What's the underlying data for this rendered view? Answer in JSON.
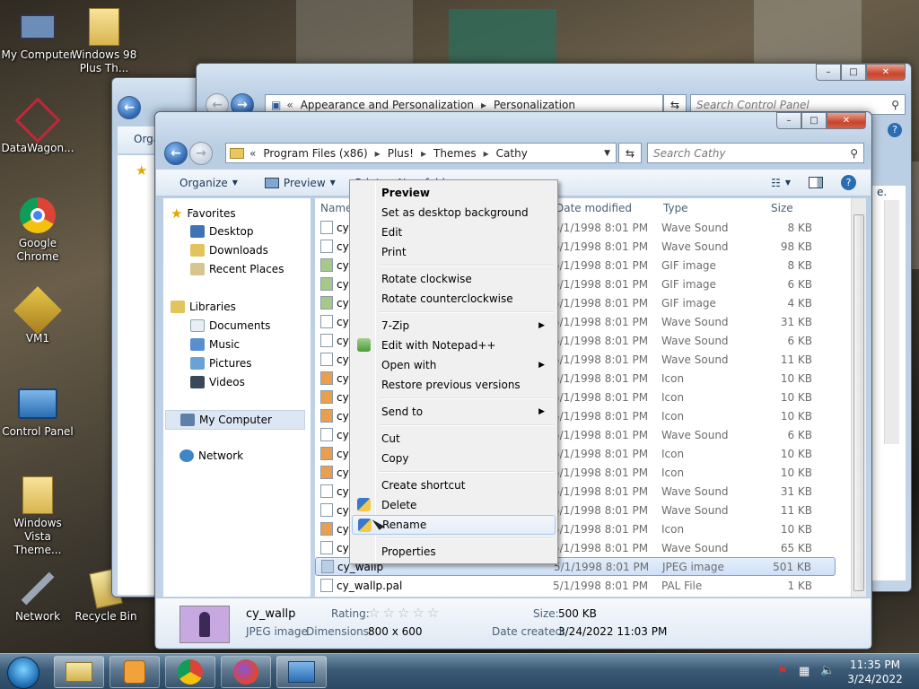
{
  "desktop": {
    "icons": [
      {
        "label": "My Computer",
        "icon": "my-computer-icon"
      },
      {
        "label": "Windows 98 Plus Th...",
        "icon": "folder-icon"
      },
      {
        "label": "DataWagon...",
        "icon": "datawagon-icon"
      },
      {
        "label": "Google Chrome",
        "icon": "chrome-icon"
      },
      {
        "label": "VM1",
        "icon": "vm-icon"
      },
      {
        "label": "Control Panel",
        "icon": "control-panel-icon"
      },
      {
        "label": "Windows Vista Theme...",
        "icon": "folder-icon"
      },
      {
        "label": "Network",
        "icon": "network-icon"
      },
      {
        "label": "Recycle Bin",
        "icon": "recycle-bin-icon"
      }
    ]
  },
  "bg_window": {
    "breadcrumb": [
      "Appearance and Personalization",
      "Personalization"
    ],
    "search_placeholder": "Search Control Panel"
  },
  "back_window": {
    "nav_label": "Orga"
  },
  "explorer": {
    "breadcrumb": [
      "Program Files (x86)",
      "Plus!",
      "Themes",
      "Cathy"
    ],
    "breadcrumb_prefix": "«",
    "search_placeholder": "Search Cathy",
    "toolbar": {
      "organize": "Organize",
      "preview": "Preview",
      "print": "Print",
      "new_folder": "New folder"
    },
    "nav": {
      "favorites": "Favorites",
      "desktop": "Desktop",
      "downloads": "Downloads",
      "recent": "Recent Places",
      "libraries": "Libraries",
      "documents": "Documents",
      "music": "Music",
      "pictures": "Pictures",
      "videos": "Videos",
      "my_computer": "My Computer",
      "network": "Network"
    },
    "columns": {
      "name": "Name",
      "date": "Date modified",
      "type": "Type",
      "size": "Size"
    },
    "files": [
      {
        "name": "cy",
        "date": "5/1/1998 8:01 PM",
        "type": "Wave Sound",
        "size": "8 KB"
      },
      {
        "name": "cy",
        "date": "5/1/1998 8:01 PM",
        "type": "Wave Sound",
        "size": "98 KB"
      },
      {
        "name": "cy",
        "date": "5/1/1998 8:01 PM",
        "type": "GIF image",
        "size": "8 KB"
      },
      {
        "name": "cy",
        "date": "5/1/1998 8:01 PM",
        "type": "GIF image",
        "size": "6 KB"
      },
      {
        "name": "cy",
        "date": "5/1/1998 8:01 PM",
        "type": "GIF image",
        "size": "4 KB"
      },
      {
        "name": "cy",
        "date": "5/1/1998 8:01 PM",
        "type": "Wave Sound",
        "size": "31 KB"
      },
      {
        "name": "cy",
        "date": "5/1/1998 8:01 PM",
        "type": "Wave Sound",
        "size": "6 KB"
      },
      {
        "name": "cy",
        "date": "5/1/1998 8:01 PM",
        "type": "Wave Sound",
        "size": "11 KB"
      },
      {
        "name": "cy",
        "date": "5/1/1998 8:01 PM",
        "type": "Icon",
        "size": "10 KB"
      },
      {
        "name": "cy",
        "date": "5/1/1998 8:01 PM",
        "type": "Icon",
        "size": "10 KB"
      },
      {
        "name": "cy",
        "date": "5/1/1998 8:01 PM",
        "type": "Icon",
        "size": "10 KB"
      },
      {
        "name": "cy",
        "date": "5/1/1998 8:01 PM",
        "type": "Wave Sound",
        "size": "6 KB"
      },
      {
        "name": "cy",
        "date": "5/1/1998 8:01 PM",
        "type": "Icon",
        "size": "10 KB"
      },
      {
        "name": "cy",
        "date": "5/1/1998 8:01 PM",
        "type": "Icon",
        "size": "10 KB"
      },
      {
        "name": "cy",
        "date": "5/1/1998 8:01 PM",
        "type": "Wave Sound",
        "size": "31 KB"
      },
      {
        "name": "cy",
        "date": "5/1/1998 8:01 PM",
        "type": "Wave Sound",
        "size": "11 KB"
      },
      {
        "name": "cy",
        "date": "5/1/1998 8:01 PM",
        "type": "Icon",
        "size": "10 KB"
      },
      {
        "name": "cy",
        "date": "5/1/1998 8:01 PM",
        "type": "Wave Sound",
        "size": "65 KB"
      },
      {
        "name": "cy_wallp",
        "date": "5/1/1998 8:01 PM",
        "type": "JPEG image",
        "size": "501 KB",
        "selected": true
      },
      {
        "name": "cy_wallp.pal",
        "date": "5/1/1998 8:01 PM",
        "type": "PAL File",
        "size": "1 KB"
      }
    ],
    "details": {
      "name": "cy_wallp",
      "type": "JPEG image",
      "rating_label": "Rating:",
      "dimensions_label": "Dimensions:",
      "dimensions": "800 x 600",
      "size_label": "Size:",
      "size": "500 KB",
      "created_label": "Date created:",
      "created": "3/24/2022 11:03 PM"
    }
  },
  "context_menu": {
    "items": [
      {
        "label": "Preview",
        "bold": true
      },
      {
        "label": "Set as desktop background"
      },
      {
        "label": "Edit"
      },
      {
        "label": "Print"
      },
      {
        "label": "Rotate clockwise"
      },
      {
        "label": "Rotate counterclockwise"
      },
      {
        "label": "7-Zip",
        "submenu": true
      },
      {
        "label": "Edit with Notepad++",
        "icon": "notepad-icon"
      },
      {
        "label": "Open with",
        "submenu": true
      },
      {
        "label": "Restore previous versions"
      },
      {
        "label": "Send to",
        "submenu": true
      },
      {
        "label": "Cut"
      },
      {
        "label": "Copy"
      },
      {
        "label": "Create shortcut"
      },
      {
        "label": "Delete",
        "icon": "shield-icon"
      },
      {
        "label": "Rename",
        "icon": "shield-icon",
        "highlighted": true
      },
      {
        "label": "Properties"
      }
    ]
  },
  "taskbar": {
    "apps": [
      "explorer-icon",
      "media-player-icon",
      "chrome-icon",
      "firefox-icon",
      "control-panel-icon"
    ],
    "time": "11:35 PM",
    "date": "3/24/2022"
  },
  "colors": {
    "accent": "#3b6ea5",
    "selection": "#cfe0f6",
    "menu_bg": "#f0f0f0"
  }
}
